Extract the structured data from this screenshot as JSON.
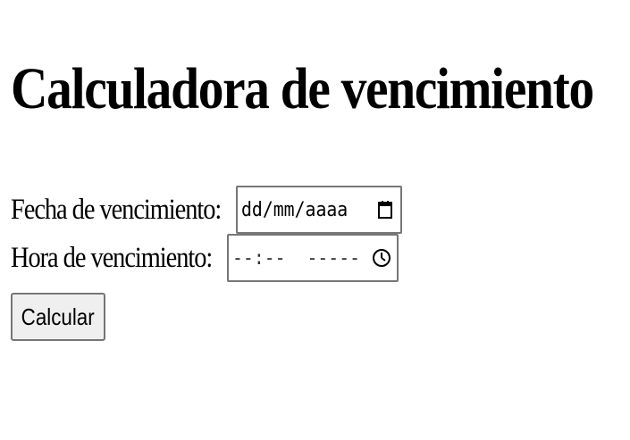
{
  "page": {
    "title": "Calculadora de vencimiento"
  },
  "form": {
    "date_label": "Fecha de vencimiento:",
    "date_placeholder": "dd/mm/aaaa",
    "time_label": "Hora de vencimiento:",
    "time_placeholder": "--:--  -----",
    "submit_label": "Calcular"
  },
  "icons": {
    "date_icon": "calendar-icon",
    "time_icon": "clock-icon"
  },
  "colors": {
    "text": "#000000",
    "field_border": "#767676",
    "button_background": "#efefef"
  }
}
